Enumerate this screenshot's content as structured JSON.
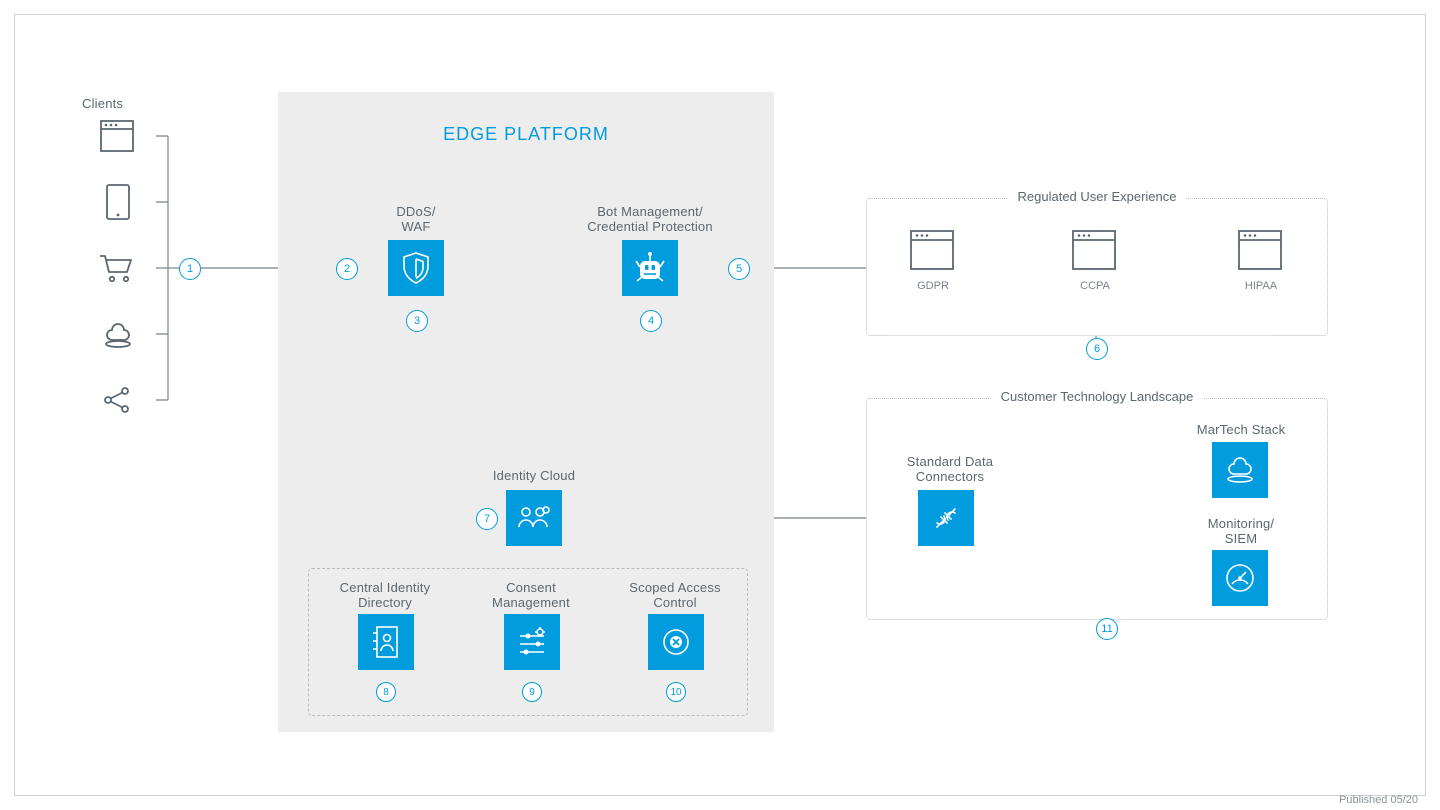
{
  "footnote": "Published 05/20",
  "clients": {
    "title": "Clients"
  },
  "edge": {
    "title": "EDGE PLATFORM",
    "ddos": {
      "l1": "DDoS/",
      "l2": "WAF"
    },
    "bot": {
      "l1": "Bot Management/",
      "l2": "Credential Protection"
    },
    "identity": "Identity Cloud",
    "dir": {
      "l1": "Central Identity",
      "l2": "Directory"
    },
    "consent": {
      "l1": "Consent",
      "l2": "Management"
    },
    "scoped": {
      "l1": "Scoped Access",
      "l2": "Control"
    }
  },
  "regulated": {
    "title": "Regulated User Experience",
    "gdpr": "GDPR",
    "ccpa": "CCPA",
    "hipaa": "HIPAA"
  },
  "tech": {
    "title": "Customer Technology Landscape",
    "connectors": {
      "l1": "Standard Data",
      "l2": "Connectors"
    },
    "martech": "MarTech Stack",
    "siem": {
      "l1": "Monitoring/",
      "l2": "SIEM"
    }
  },
  "nums": {
    "n1": "1",
    "n2": "2",
    "n3": "3",
    "n4": "4",
    "n5": "5",
    "n6": "6",
    "n7": "7",
    "n8": "8",
    "n9": "9",
    "n10": "10",
    "n11": "11"
  }
}
